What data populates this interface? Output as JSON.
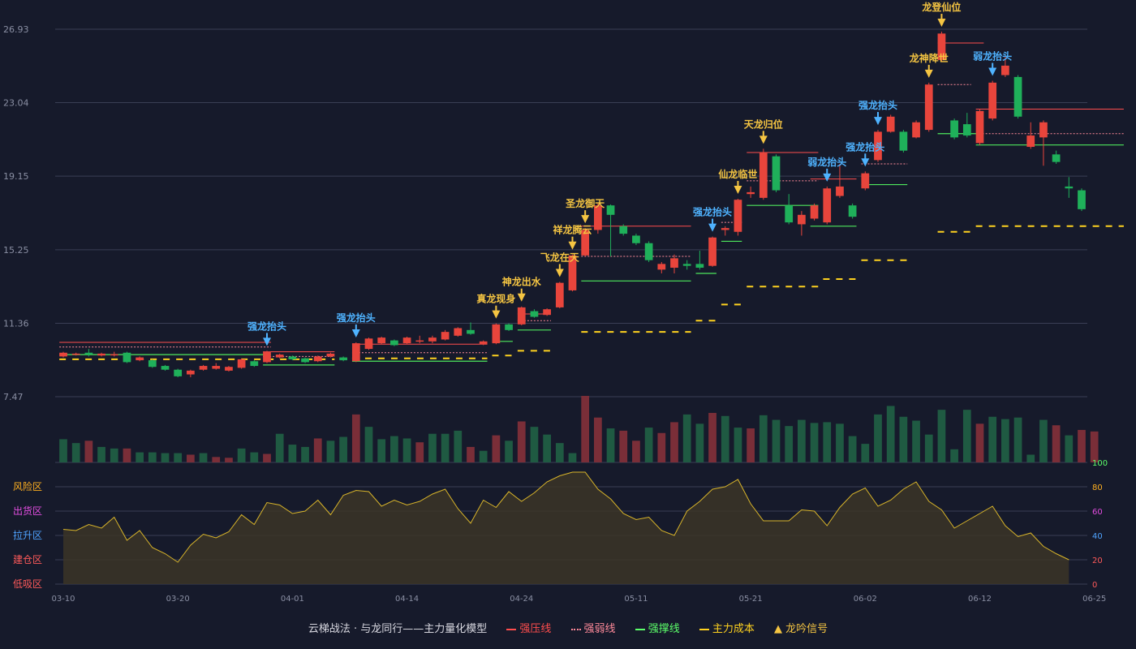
{
  "chart_data": {
    "type": "candlestick",
    "price_axis": {
      "ticks": [
        26.93,
        23.04,
        19.15,
        15.25,
        11.36,
        7.47
      ],
      "ylim": [
        7.47,
        26.93
      ]
    },
    "x_ticks": [
      {
        "i": 0,
        "label": "03-10"
      },
      {
        "i": 9,
        "label": "03-20"
      },
      {
        "i": 18,
        "label": "04-01"
      },
      {
        "i": 27,
        "label": "04-14"
      },
      {
        "i": 36,
        "label": "04-24"
      },
      {
        "i": 45,
        "label": "05-11"
      },
      {
        "i": 54,
        "label": "05-21"
      },
      {
        "i": 63,
        "label": "06-02"
      },
      {
        "i": 72,
        "label": "06-12"
      },
      {
        "i": 81,
        "label": "06-25"
      }
    ],
    "candles": [
      [
        9.6,
        9.8,
        9.55,
        9.85
      ],
      [
        9.7,
        9.75,
        9.65,
        9.8
      ],
      [
        9.8,
        9.7,
        9.6,
        10.0
      ],
      [
        9.65,
        9.75,
        9.6,
        9.8
      ],
      [
        9.7,
        9.72,
        9.6,
        9.85
      ],
      [
        9.8,
        9.3,
        9.25,
        9.85
      ],
      [
        9.4,
        9.55,
        9.35,
        9.6
      ],
      [
        9.4,
        9.05,
        9.0,
        9.45
      ],
      [
        9.1,
        8.9,
        8.85,
        9.15
      ],
      [
        8.9,
        8.55,
        8.5,
        8.95
      ],
      [
        8.65,
        8.85,
        8.5,
        8.9
      ],
      [
        8.9,
        9.1,
        8.85,
        9.15
      ],
      [
        8.95,
        9.1,
        8.9,
        9.25
      ],
      [
        8.85,
        9.05,
        8.8,
        9.1
      ],
      [
        9.0,
        9.45,
        8.95,
        9.5
      ],
      [
        9.35,
        9.1,
        9.05,
        9.4
      ],
      [
        9.3,
        9.85,
        9.25,
        9.9
      ],
      [
        9.55,
        9.7,
        9.5,
        9.75
      ],
      [
        9.6,
        9.45,
        9.4,
        9.65
      ],
      [
        9.5,
        9.3,
        9.25,
        9.55
      ],
      [
        9.35,
        9.6,
        9.3,
        9.65
      ],
      [
        9.6,
        9.75,
        9.55,
        9.8
      ],
      [
        9.55,
        9.4,
        9.35,
        9.6
      ],
      [
        9.35,
        10.3,
        9.3,
        10.35
      ],
      [
        10.0,
        10.55,
        9.95,
        10.6
      ],
      [
        10.3,
        10.6,
        10.25,
        10.65
      ],
      [
        10.45,
        10.2,
        10.15,
        10.5
      ],
      [
        10.3,
        10.6,
        10.25,
        10.65
      ],
      [
        10.4,
        10.45,
        10.3,
        10.7
      ],
      [
        10.4,
        10.6,
        10.3,
        10.7
      ],
      [
        10.5,
        10.9,
        10.45,
        11.0
      ],
      [
        10.7,
        11.1,
        10.65,
        11.15
      ],
      [
        11.0,
        10.8,
        10.75,
        11.4
      ],
      [
        10.25,
        10.4,
        10.2,
        10.45
      ],
      [
        10.3,
        11.3,
        10.25,
        11.35
      ],
      [
        11.3,
        11.0,
        10.95,
        11.35
      ],
      [
        11.3,
        12.2,
        11.25,
        12.25
      ],
      [
        12.0,
        11.7,
        11.65,
        12.1
      ],
      [
        11.8,
        12.1,
        11.75,
        12.15
      ],
      [
        12.2,
        13.5,
        12.15,
        13.55
      ],
      [
        13.1,
        14.95,
        13.05,
        15.0
      ],
      [
        14.95,
        16.3,
        14.9,
        16.4
      ],
      [
        16.3,
        17.6,
        16.1,
        17.7
      ],
      [
        17.6,
        17.1,
        14.9,
        17.65
      ],
      [
        16.5,
        16.1,
        16.0,
        16.6
      ],
      [
        16.0,
        15.6,
        15.5,
        16.1
      ],
      [
        15.6,
        14.7,
        14.6,
        15.7
      ],
      [
        14.2,
        14.5,
        14.0,
        14.6
      ],
      [
        14.3,
        14.8,
        14.0,
        15.0
      ],
      [
        14.5,
        14.4,
        14.2,
        14.7
      ],
      [
        14.5,
        14.3,
        14.2,
        15.2
      ],
      [
        14.4,
        15.9,
        14.35,
        15.95
      ],
      [
        16.3,
        16.4,
        16.0,
        16.5
      ],
      [
        16.2,
        17.9,
        16.0,
        17.95
      ],
      [
        18.2,
        18.3,
        18.0,
        18.6
      ],
      [
        18.0,
        20.4,
        17.9,
        20.6
      ],
      [
        20.2,
        18.4,
        18.3,
        20.3
      ],
      [
        17.6,
        16.7,
        16.6,
        18.2
      ],
      [
        16.6,
        17.1,
        16.0,
        17.3
      ],
      [
        16.9,
        17.6,
        16.8,
        17.7
      ],
      [
        16.7,
        18.5,
        16.6,
        18.6
      ],
      [
        18.1,
        18.6,
        18.0,
        19.8
      ],
      [
        17.6,
        17.0,
        16.9,
        17.7
      ],
      [
        18.5,
        19.3,
        18.4,
        19.4
      ],
      [
        20.0,
        21.5,
        19.9,
        21.6
      ],
      [
        21.5,
        22.3,
        21.45,
        22.4
      ],
      [
        21.5,
        20.5,
        20.4,
        21.6
      ],
      [
        21.2,
        22.0,
        21.15,
        22.1
      ],
      [
        21.6,
        24.0,
        21.5,
        24.1
      ],
      [
        25.3,
        26.7,
        25.2,
        26.8
      ],
      [
        22.1,
        21.2,
        21.1,
        22.2
      ],
      [
        21.9,
        21.3,
        21.2,
        22.5
      ],
      [
        20.9,
        22.6,
        20.8,
        22.7
      ],
      [
        22.2,
        24.1,
        22.1,
        24.2
      ],
      [
        24.5,
        25.0,
        24.4,
        25.5
      ],
      [
        24.4,
        22.3,
        22.2,
        24.5
      ],
      [
        20.7,
        21.3,
        20.6,
        22.0
      ],
      [
        21.2,
        22.0,
        19.7,
        22.1
      ],
      [
        20.3,
        19.9,
        19.8,
        20.5
      ],
      [
        18.6,
        18.5,
        18.0,
        19.1
      ],
      [
        18.4,
        17.4,
        17.3,
        18.5
      ]
    ],
    "volumes": [
      30,
      25,
      28,
      20,
      18,
      18,
      13,
      13,
      12,
      12,
      10,
      12,
      7,
      6,
      18,
      13,
      11,
      37,
      23,
      20,
      31,
      28,
      33,
      62,
      46,
      30,
      34,
      31,
      26,
      37,
      37,
      41,
      20,
      15,
      35,
      28,
      53,
      46,
      36,
      25,
      12,
      86,
      58,
      44,
      41,
      28,
      45,
      38,
      52,
      62,
      50,
      64,
      60,
      45,
      44,
      61,
      55,
      47,
      55,
      51,
      52,
      50,
      34,
      24,
      62,
      73,
      59,
      54,
      36,
      68,
      17,
      68,
      50,
      59,
      56,
      58,
      10,
      55,
      48,
      35,
      42,
      40
    ],
    "vol_up": [
      false,
      false,
      true,
      false,
      false,
      true,
      false,
      false,
      false,
      false,
      true,
      false,
      true,
      true,
      false,
      false,
      true,
      false,
      false,
      false,
      true,
      false,
      false,
      true,
      false,
      false,
      false,
      false,
      true,
      false,
      false,
      false,
      true,
      false,
      true,
      false,
      true,
      false,
      false,
      false,
      false,
      true,
      true,
      false,
      true,
      true,
      false,
      true,
      true,
      false,
      false,
      true,
      false,
      false,
      true,
      false,
      false,
      false,
      false,
      false,
      false,
      false,
      false,
      false,
      false,
      false,
      false,
      false,
      false,
      false,
      false,
      false,
      true,
      false,
      false,
      false,
      false,
      false,
      true,
      false,
      true,
      true
    ],
    "pressure_lines": [
      {
        "from": 0,
        "to": 16,
        "price": 10.35
      },
      {
        "from": 16,
        "to": 21,
        "price": 9.85
      },
      {
        "from": 23,
        "to": 33,
        "price": 10.25
      },
      {
        "from": 36,
        "to": 38,
        "price": 11.85
      },
      {
        "from": 41,
        "to": 49,
        "price": 16.5
      },
      {
        "from": 54,
        "to": 59,
        "price": 20.4
      },
      {
        "from": 69,
        "to": 72,
        "price": 26.2
      },
      {
        "from": 72,
        "to": 83,
        "price": 22.7
      },
      {
        "from": 59,
        "to": 62,
        "price": 19.0
      }
    ],
    "weak_lines": [
      {
        "from": 0,
        "to": 16,
        "price": 10.1
      },
      {
        "from": 16,
        "to": 21,
        "price": 9.6
      },
      {
        "from": 23,
        "to": 33,
        "price": 9.8
      },
      {
        "from": 41,
        "to": 49,
        "price": 14.9
      },
      {
        "from": 54,
        "to": 59,
        "price": 18.9
      },
      {
        "from": 63,
        "to": 66,
        "price": 19.8
      },
      {
        "from": 69,
        "to": 71,
        "price": 24.0
      },
      {
        "from": 72,
        "to": 83,
        "price": 21.4
      },
      {
        "from": 36,
        "to": 38,
        "price": 11.5
      },
      {
        "from": 52,
        "to": 53,
        "price": 16.7
      }
    ],
    "support_lines": [
      {
        "from": 0,
        "to": 16,
        "price": 9.7
      },
      {
        "from": 16,
        "to": 21,
        "price": 9.15
      },
      {
        "from": 23,
        "to": 33,
        "price": 9.35
      },
      {
        "from": 34,
        "to": 35,
        "price": 10.4
      },
      {
        "from": 36,
        "to": 38,
        "price": 11.0
      },
      {
        "from": 41,
        "to": 49,
        "price": 13.6
      },
      {
        "from": 50,
        "to": 51,
        "price": 14.0
      },
      {
        "from": 52,
        "to": 53,
        "price": 15.7
      },
      {
        "from": 54,
        "to": 59,
        "price": 17.6
      },
      {
        "from": 59,
        "to": 62,
        "price": 16.5
      },
      {
        "from": 63,
        "to": 66,
        "price": 18.7
      },
      {
        "from": 69,
        "to": 72,
        "price": 21.4
      },
      {
        "from": 72,
        "to": 83,
        "price": 20.8
      }
    ],
    "cost_lines": [
      {
        "from": 0,
        "to": 21,
        "price": 9.45
      },
      {
        "from": 23,
        "to": 33,
        "price": 9.5
      },
      {
        "from": 34,
        "to": 35,
        "price": 9.65
      },
      {
        "from": 36,
        "to": 38,
        "price": 9.9
      },
      {
        "from": 41,
        "to": 49,
        "price": 10.9
      },
      {
        "from": 50,
        "to": 51,
        "price": 11.5
      },
      {
        "from": 52,
        "to": 53,
        "price": 12.35
      },
      {
        "from": 54,
        "to": 59,
        "price": 13.3
      },
      {
        "from": 60,
        "to": 62,
        "price": 13.7
      },
      {
        "from": 63,
        "to": 66,
        "price": 14.7
      },
      {
        "from": 69,
        "to": 71,
        "price": 16.2
      },
      {
        "from": 72,
        "to": 83,
        "price": 16.5
      }
    ],
    "signals": [
      {
        "i": 16,
        "text": "强龙抬头",
        "kind": "blue"
      },
      {
        "i": 23,
        "text": "强龙抬头",
        "kind": "blue"
      },
      {
        "i": 34,
        "text": "真龙现身",
        "kind": "gold"
      },
      {
        "i": 36,
        "text": "神龙出水",
        "kind": "gold"
      },
      {
        "i": 39,
        "text": "飞龙在天",
        "kind": "gold"
      },
      {
        "i": 40,
        "text": "祥龙腾云",
        "kind": "gold"
      },
      {
        "i": 41,
        "text": "圣龙御天",
        "kind": "gold"
      },
      {
        "i": 51,
        "text": "强龙抬头",
        "kind": "blue"
      },
      {
        "i": 53,
        "text": "仙龙临世",
        "kind": "gold"
      },
      {
        "i": 55,
        "text": "天龙归位",
        "kind": "gold"
      },
      {
        "i": 60,
        "text": "弱龙抬头",
        "kind": "blue"
      },
      {
        "i": 63,
        "text": "强龙抬头",
        "kind": "blue"
      },
      {
        "i": 64,
        "text": "强龙抬头",
        "kind": "blue"
      },
      {
        "i": 68,
        "text": "龙神降世",
        "kind": "gold"
      },
      {
        "i": 69,
        "text": "龙登仙位",
        "kind": "gold"
      },
      {
        "i": 73,
        "text": "弱龙抬头",
        "kind": "blue"
      }
    ],
    "oscillator": {
      "ticks": [
        100,
        80,
        60,
        40,
        20,
        0
      ],
      "zones": [
        "风险区",
        "出货区",
        "拉升区",
        "建仓区",
        "低吸区"
      ],
      "values": [
        45,
        44,
        49,
        46,
        55,
        36,
        44,
        30,
        25,
        18,
        32,
        41,
        38,
        43,
        57,
        49,
        67,
        65,
        58,
        60,
        69,
        57,
        73,
        77,
        76,
        64,
        69,
        65,
        68,
        74,
        78,
        62,
        50,
        69,
        63,
        76,
        68,
        75,
        84,
        89,
        92,
        92,
        78,
        70,
        58,
        53,
        55,
        44,
        40,
        60,
        68,
        78,
        80,
        86,
        66,
        52,
        52,
        52,
        61,
        60,
        48,
        63,
        74,
        79,
        64,
        69,
        78,
        84,
        68,
        61,
        46,
        52,
        58,
        64,
        48,
        39,
        42,
        31,
        25,
        20
      ]
    }
  },
  "legend": {
    "title": "云梯战法 · 与龙同行——主力量化模型",
    "items": [
      {
        "label": "强压线",
        "color": "#ff4d4d"
      },
      {
        "label": "强弱线",
        "color": "#ff8a9a"
      },
      {
        "label": "强撑线",
        "color": "#5cff6a"
      },
      {
        "label": "主力成本",
        "color": "#ffd21f"
      },
      {
        "label": "龙吟信号",
        "color": "#f5c542"
      }
    ]
  },
  "colors": {
    "up": "#e8453c",
    "down": "#1fb05a",
    "vol_up": "#7a2e38",
    "vol_down": "#1f5a42",
    "blue_signal": "#4fb3ff",
    "gold_signal": "#f5c542",
    "osc_line": "#d9b52a"
  }
}
